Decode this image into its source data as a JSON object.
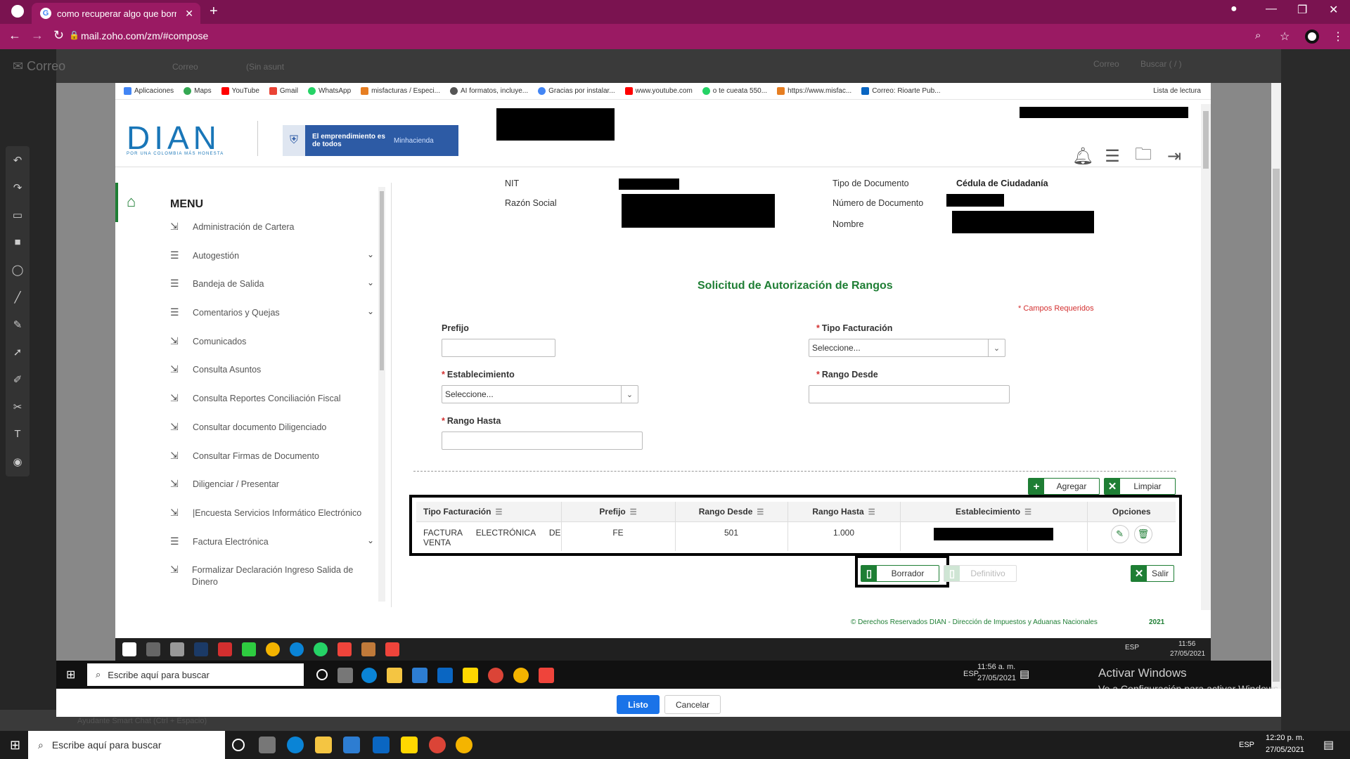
{
  "browser": {
    "tab_title": "como recuperar algo que borre e",
    "url": "mail.zoho.com/zm/#compose"
  },
  "zoho": {
    "brand": "Correo",
    "tab1": "Correo",
    "tab2": "(Sin asunt",
    "search_label": "Correo",
    "search_placeholder": "Buscar ( / )",
    "footer_label": "Ayudante Smart Chat (Ctrl + Espacio)"
  },
  "modal": {
    "ok_label": "Listo",
    "cancel_label": "Cancelar",
    "activate_title": "Activar Windows",
    "activate_sub": "Ve a Configuración para activar Windows."
  },
  "bookmarks": {
    "items": [
      "Aplicaciones",
      "Maps",
      "YouTube",
      "Gmail",
      "WhatsApp",
      "misfacturas / Especi...",
      "AI formatos, incluye...",
      "Gracias por instalar...",
      "www.youtube.com",
      "o te cueata 550...",
      "https://www.misfac...",
      "Correo: Rioarte Pub..."
    ],
    "reading_list": "Lista de lectura"
  },
  "header": {
    "logo": "DIAN",
    "logo_sub": "POR UNA COLOMBIA MÁS HONESTA",
    "banner_text": "El emprendimiento es de todos",
    "banner_ministry": "Minhacienda"
  },
  "sidebar": {
    "menu_title": "MENU",
    "items": [
      {
        "label": "Administración de Cartera",
        "icon": "login-icon"
      },
      {
        "label": "Autogestión",
        "icon": "list-icon",
        "expand": true
      },
      {
        "label": "Bandeja de Salida",
        "icon": "list-icon",
        "expand": true
      },
      {
        "label": "Comentarios y Quejas",
        "icon": "list-icon",
        "expand": true
      },
      {
        "label": "Comunicados",
        "icon": "login-icon"
      },
      {
        "label": "Consulta Asuntos",
        "icon": "login-icon"
      },
      {
        "label": "Consulta Reportes Conciliación Fiscal",
        "icon": "login-icon"
      },
      {
        "label": "Consultar documento Diligenciado",
        "icon": "login-icon"
      },
      {
        "label": "Consultar Firmas de Documento",
        "icon": "login-icon"
      },
      {
        "label": "Diligenciar / Presentar",
        "icon": "login-icon"
      },
      {
        "label": "|Encuesta Servicios Informático Electrónico",
        "icon": "login-icon"
      },
      {
        "label": "Factura Electrónica",
        "icon": "list-icon",
        "expand": true
      },
      {
        "label": "Formalizar Declaración Ingreso Salida de Dinero",
        "icon": "login-icon"
      }
    ]
  },
  "info": {
    "nit_label": "NIT",
    "razon_label": "Razón Social",
    "tipo_doc_label": "Tipo de Documento",
    "tipo_doc_value": "Cédula de Ciudadanía",
    "num_doc_label": "Número de Documento",
    "nombre_label": "Nombre"
  },
  "form": {
    "title": "Solicitud de Autorización de Rangos",
    "required_note": "* Campos Requeridos",
    "prefijo_label": "Prefijo",
    "tipo_fact_label": "Tipo Facturación",
    "tipo_fact_value": "Seleccione...",
    "establecimiento_label": "Establecimiento",
    "establecimiento_value": "Seleccione...",
    "rango_desde_label": "Rango Desde",
    "rango_hasta_label": "Rango Hasta",
    "add_label": "Agregar",
    "clear_label": "Limpiar"
  },
  "table": {
    "headers": [
      "Tipo Facturación",
      "Prefijo",
      "Rango Desde",
      "Rango Hasta",
      "Establecimiento",
      "Opciones"
    ],
    "rows": [
      {
        "tipo": "FACTURA ELECTRÓNICA DE VENTA",
        "prefijo": "FE",
        "desde": "501",
        "hasta": "1.000"
      }
    ]
  },
  "actions": {
    "draft_label": "Borrador",
    "final_label": "Definitivo",
    "exit_label": "Salir"
  },
  "footer": {
    "copyright": "© Derechos Reservados DIAN - Dirección de Impuestos y Aduanas Nacionales",
    "year": "2021"
  },
  "inner_taskbar": {
    "time": "11:56",
    "date": "27/05/2021",
    "lang": "ESP"
  },
  "mid_taskbar": {
    "search_placeholder": "Escribe aquí para buscar",
    "time": "11:56 a. m.",
    "date": "27/05/2021",
    "lang": "ESP"
  },
  "taskbar": {
    "search_placeholder": "Escribe aquí para buscar",
    "time": "12:20 p. m.",
    "date": "27/05/2021",
    "lang": "ESP"
  },
  "colors": {
    "chrome": "#9a1a63",
    "dian_green": "#1e7e34",
    "dian_blue": "#1976b8",
    "required_red": "#d32f2f"
  }
}
